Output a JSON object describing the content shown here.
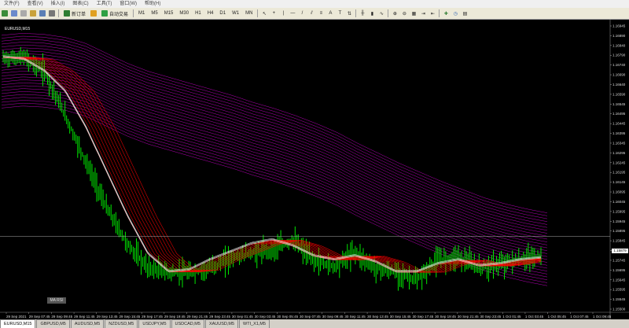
{
  "menu": [
    "文件(F)",
    "查看(V)",
    "插入(I)",
    "图表(C)",
    "工具(T)",
    "窗口(W)",
    "帮助(H)"
  ],
  "toolbar": {
    "new_order": "新订单",
    "auto_trading": "自动交易",
    "timeframes": [
      "M1",
      "M5",
      "M15",
      "M30",
      "H1",
      "H4",
      "D1",
      "W1",
      "MN"
    ]
  },
  "chart": {
    "title": "EURUSD,M15",
    "indicator_label": "MA RSI",
    "current_price": "1.15879",
    "colors": {
      "background": "#000000",
      "candles": "#00ff00",
      "ma_fast": "#ff0000",
      "ma_slow": "#cc00cc",
      "ma_white": "#ffffff",
      "price_line": "#aaaaaa"
    }
  },
  "chart_data": {
    "type": "line",
    "symbol": "EURUSD",
    "timeframe": "M15",
    "ylim": [
      1.155,
      1.1695
    ],
    "price_ticks": [
      "1.16945",
      "1.16890",
      "1.16840",
      "1.16790",
      "1.16740",
      "1.16690",
      "1.16640",
      "1.16590",
      "1.16545",
      "1.16495",
      "1.16445",
      "1.16395",
      "1.16345",
      "1.16295",
      "1.16245",
      "1.16195",
      "1.16145",
      "1.16095",
      "1.16045",
      "1.15995",
      "1.15945",
      "1.15895",
      "1.15845",
      "1.15795",
      "1.15745",
      "1.15695",
      "1.15645",
      "1.15595",
      "1.15545",
      "1.15500"
    ],
    "time_ticks": [
      "29 Sep 2021",
      "29 Sep 07:45",
      "29 Sep 09:45",
      "29 Sep 11:45",
      "29 Sep 13:45",
      "29 Sep 15:45",
      "29 Sep 17:45",
      "29 Sep 19:45",
      "29 Sep 21:45",
      "29 Sep 23:45",
      "30 Sep 01:45",
      "30 Sep 03:45",
      "30 Sep 05:45",
      "30 Sep 07:45",
      "30 Sep 09:45",
      "30 Sep 11:45",
      "30 Sep 13:45",
      "30 Sep 15:45",
      "30 Sep 17:45",
      "30 Sep 19:45",
      "30 Sep 21:45",
      "30 Sep 23:45",
      "1 Oct 01:45",
      "1 Oct 03:45",
      "1 Oct 05:45",
      "1 Oct 07:45",
      "1 Oct 09:45"
    ],
    "series": [
      {
        "values": [
          1.1688,
          1.1689,
          1.16885,
          1.1687,
          1.1684,
          1.1679,
          1.1674,
          1.167,
          1.1667,
          1.1664,
          1.1661,
          1.1658,
          1.16545,
          1.16515,
          1.1648,
          1.1644,
          1.16395,
          1.1634,
          1.1629,
          1.1624,
          1.16195,
          1.1615,
          1.1611,
          1.1607,
          1.1604,
          1.16015,
          1.15995
        ]
      },
      {
        "values": [
          1.16765,
          1.1677,
          1.167,
          1.1648,
          1.1625,
          1.1602,
          1.1584,
          1.1572,
          1.157,
          1.15695,
          1.1572,
          1.1577,
          1.15795,
          1.1581,
          1.1586,
          1.1576,
          1.1573,
          1.158,
          1.1572,
          1.157,
          1.1566,
          1.1576,
          1.1578,
          1.1572,
          1.1574,
          1.1576,
          1.1578
        ]
      },
      {
        "values": [
          1.1677,
          1.1676,
          1.167,
          1.166,
          1.1642,
          1.162,
          1.1598,
          1.1579,
          1.157,
          1.1571,
          1.1576,
          1.158,
          1.1584,
          1.1586,
          1.1583,
          1.1578,
          1.1576,
          1.1578,
          1.1575,
          1.157,
          1.157,
          1.1574,
          1.1576,
          1.1573,
          1.1574,
          1.1576,
          1.1577
        ]
      }
    ],
    "current_price": 1.15879
  },
  "tabs": [
    "EURUSD,M15",
    "GBPUSD,M5",
    "AUDUSD,M5",
    "NZDUSD,M5",
    "USDJPY,M5",
    "USDCAD,M5",
    "XAUUSD,M5",
    "WTI_X1,M5"
  ]
}
